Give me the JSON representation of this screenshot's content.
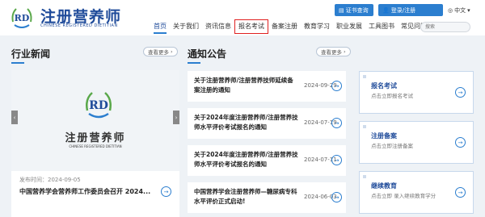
{
  "header": {
    "brand_cn": "注册营养师",
    "brand_en": "CHINESE REGISTERED DIETITIAN",
    "logo_text": "RD",
    "cert_query": "证书查询",
    "login": "登录/注册",
    "language": "中文"
  },
  "nav": {
    "items": [
      {
        "label": "首页",
        "active": true,
        "highlight": false
      },
      {
        "label": "关于我们",
        "active": false,
        "highlight": false
      },
      {
        "label": "资讯信息",
        "active": false,
        "highlight": false
      },
      {
        "label": "报名考试",
        "active": false,
        "highlight": true
      },
      {
        "label": "备案注册",
        "active": false,
        "highlight": false
      },
      {
        "label": "教育学习",
        "active": false,
        "highlight": false
      },
      {
        "label": "职业发展",
        "active": false,
        "highlight": false
      },
      {
        "label": "工具图书",
        "active": false,
        "highlight": false
      },
      {
        "label": "常见问题",
        "active": false,
        "highlight": false
      }
    ],
    "search_placeholder": "搜索"
  },
  "industry_news": {
    "title": "行业新闻",
    "more": "查看更多",
    "image_cn": "注册营养师",
    "image_en": "CHINESE REGISTERED DIETITIAN",
    "date": "发布时间：2024-09-05",
    "headline": "中国营养学会营养师工作委员会召开 2024..."
  },
  "notices": {
    "title": "通知公告",
    "more": "查看更多",
    "items": [
      {
        "title": "关于注册营养师/注册营养技师延续备案注册的通知",
        "date": "2024-09-29"
      },
      {
        "title": "关于2024年度注册营养师/注册营养技师水平评价考试报名的通知",
        "date": "2024-07-19"
      },
      {
        "title": "关于2024年度注册营养师/注册营养技师水平评价考试报名的通知",
        "date": "2024-07-11"
      },
      {
        "title": "中国营养学会注册营养师—糖尿病专科水平评价正式启动!",
        "date": "2024-06-03"
      }
    ]
  },
  "quick_links": [
    {
      "title": "报名考试",
      "sub": "点击立即报名考试"
    },
    {
      "title": "注册备案",
      "sub": "点击立即注册备案"
    },
    {
      "title": "继续教育",
      "sub": "点击立即 录入继续教育学分"
    }
  ],
  "colors": {
    "brand": "#1f4b9a",
    "accent": "#2b7ecf",
    "highlight_border": "#e02020",
    "page_bg": "#eef2f6"
  }
}
